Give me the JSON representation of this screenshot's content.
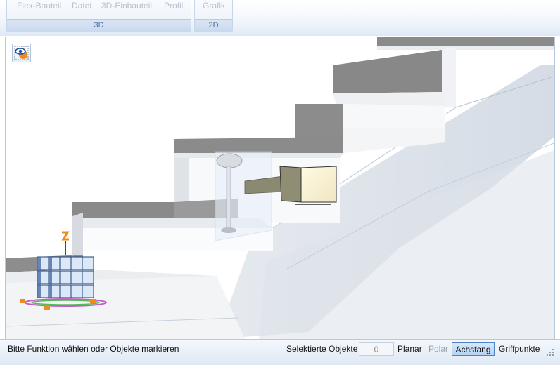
{
  "ribbon": {
    "buttons_3d": [
      "Flex-Bauteil",
      "Datei",
      "3D-Einbauteil",
      "Profil"
    ],
    "group_3d_label": "3D",
    "buttons_2d": [
      "Grafik"
    ],
    "group_2d_label": "2D"
  },
  "viewport": {
    "view_button_icon": "eye-icon"
  },
  "statusbar": {
    "message": "Bitte Funktion wählen oder Objekte markieren",
    "selected_label": "Selektierte Objekte",
    "selected_count": "0",
    "planar": "Planar",
    "polar": "Polar",
    "achsfang": "Achsfang",
    "griffpunkte": "Griffpunkte",
    "grip_icon": "resize-grip-icon"
  },
  "colors": {
    "ribbon_label": "#4a6aa0",
    "active_toggle_border": "#4d82c3",
    "disabled_text": "#9aa3ad"
  }
}
